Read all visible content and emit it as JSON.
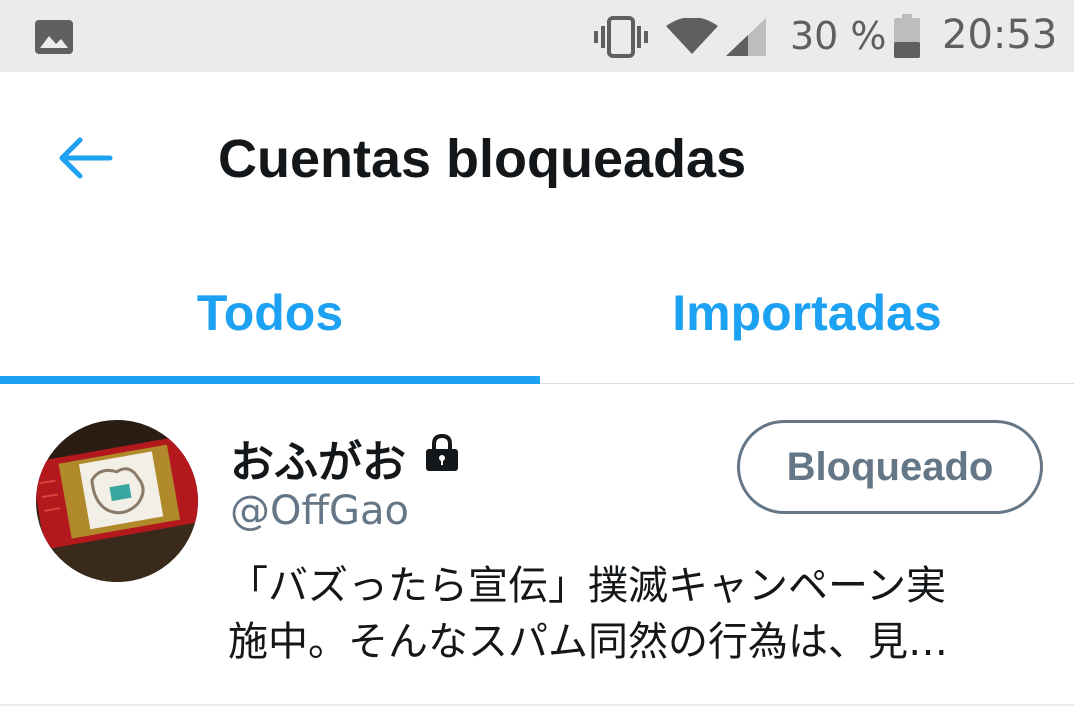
{
  "status_bar": {
    "battery_percent": "30 %",
    "time": "20:53",
    "icons": [
      "image-icon",
      "vibrate-icon",
      "wifi-icon",
      "signal-icon",
      "battery-icon"
    ]
  },
  "header": {
    "back_icon": "arrow-left-icon",
    "title": "Cuentas bloqueadas"
  },
  "tabs": [
    {
      "label": "Todos",
      "active": true
    },
    {
      "label": "Importadas",
      "active": false
    }
  ],
  "colors": {
    "accent": "#1da1f2",
    "muted": "#657786",
    "text": "#14171a",
    "status_bar_bg": "#ebebeb"
  },
  "accounts": [
    {
      "display_name": "おふがお",
      "protected_icon": "lock-icon",
      "username": "@OffGao",
      "bio": "「バズったら宣伝」撲滅キャンペーン実\n施中。そんなスパム同然の行為は、見…",
      "button_label": "Bloqueado"
    }
  ]
}
